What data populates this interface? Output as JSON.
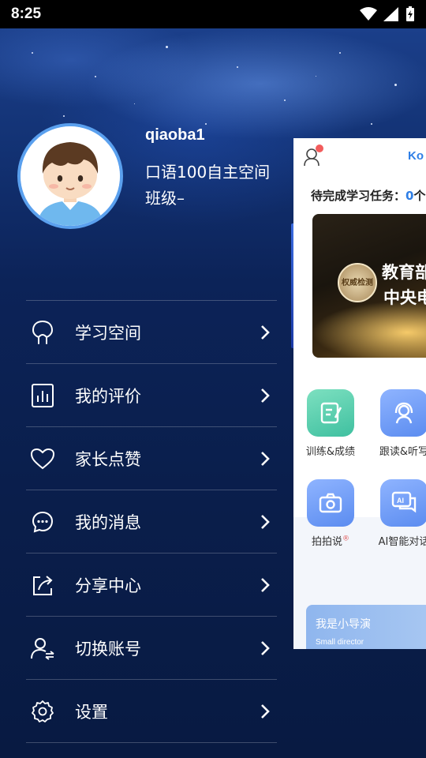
{
  "status_bar": {
    "time": "8:25"
  },
  "profile": {
    "username": "qiaoba1",
    "space_name": "口语100自主空间",
    "class_name": "班级–"
  },
  "menu": [
    {
      "label": "学习空间",
      "icon": "brain-icon"
    },
    {
      "label": "我的评价",
      "icon": "bar-chart-icon"
    },
    {
      "label": "家长点赞",
      "icon": "heart-icon"
    },
    {
      "label": "我的消息",
      "icon": "message-icon"
    },
    {
      "label": "分享中心",
      "icon": "share-icon"
    },
    {
      "label": "切换账号",
      "icon": "switch-user-icon"
    },
    {
      "label": "设置",
      "icon": "gear-icon"
    }
  ],
  "preview": {
    "logo": "Ko",
    "tasks_label": "待完成学习任务：",
    "tasks_count": "0",
    "tasks_suffix": "个",
    "banner_title": "教育部",
    "banner_sub": "中央电",
    "banner_badge": "权威检测",
    "features": [
      {
        "label": "训练&成绩",
        "icon": "edit-note-icon"
      },
      {
        "label": "跟读&听写",
        "icon": "headset-icon"
      },
      {
        "label": "拍拍说",
        "icon": "camera-icon",
        "sup": "®"
      },
      {
        "label": "AI智能对话",
        "icon": "ai-chat-icon"
      }
    ],
    "director_title": "我是小导演",
    "director_sub": "Small director"
  },
  "colors": {
    "accent": "#2f7fe6",
    "menu_bg": "#0a1e47"
  }
}
